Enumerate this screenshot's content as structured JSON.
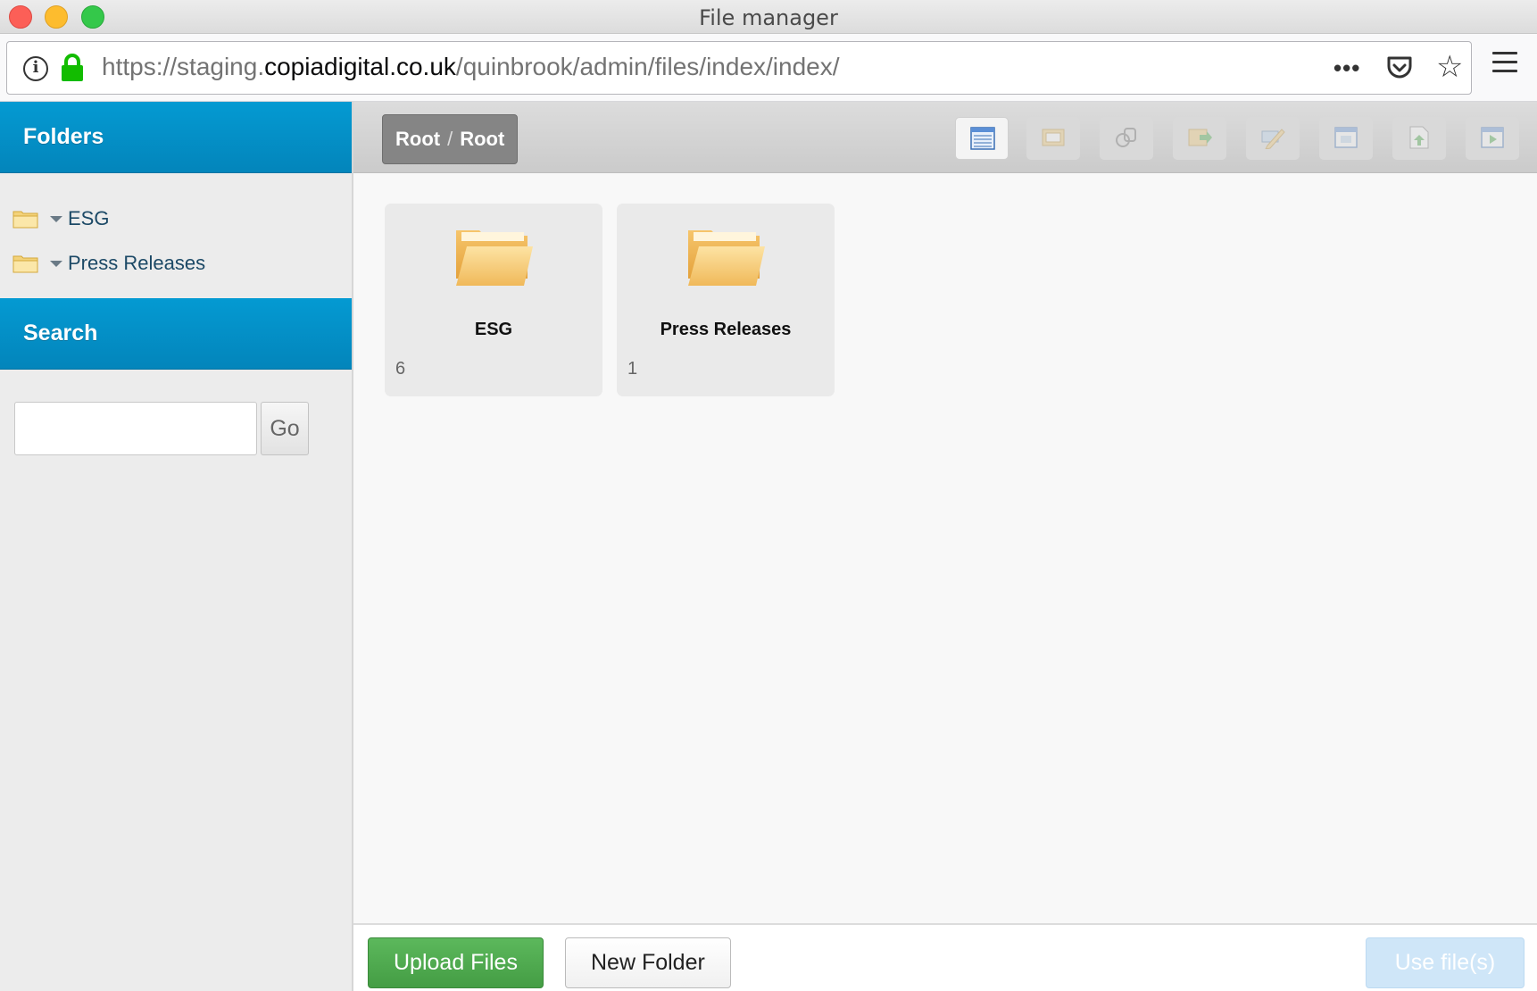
{
  "window": {
    "title": "File manager"
  },
  "browser": {
    "url_scheme": "https://staging.",
    "url_host": "copiadigital.co.uk",
    "url_path": "/quinbrook/admin/files/index/index/",
    "more_label": "•••",
    "star_label": "☆"
  },
  "sidebar": {
    "folders_heading": "Folders",
    "tree": [
      {
        "label": "ESG"
      },
      {
        "label": "Press Releases"
      }
    ],
    "search_heading": "Search",
    "search_placeholder": "",
    "search_value": "",
    "go_label": "Go"
  },
  "main": {
    "breadcrumb": [
      "Root",
      "Root"
    ],
    "breadcrumb_separator": "/",
    "tools": [
      {
        "icon": "list-view-icon",
        "active": true
      },
      {
        "icon": "image-view-icon",
        "active": false
      },
      {
        "icon": "permissions-icon",
        "active": false
      },
      {
        "icon": "move-icon",
        "active": false
      },
      {
        "icon": "rename-icon",
        "active": false
      },
      {
        "icon": "window-icon",
        "active": false
      },
      {
        "icon": "upload-file-icon",
        "active": false
      },
      {
        "icon": "preview-icon",
        "active": false
      }
    ],
    "folders": [
      {
        "name": "ESG",
        "count": "6"
      },
      {
        "name": "Press Releases",
        "count": "1"
      }
    ]
  },
  "footer": {
    "upload_label": "Upload Files",
    "new_folder_label": "New Folder",
    "use_files_label": "Use file(s)"
  },
  "colors": {
    "panel_header": "#0390c6",
    "upload_button": "#4cae4c",
    "use_files_disabled": "#cfe6f8"
  }
}
